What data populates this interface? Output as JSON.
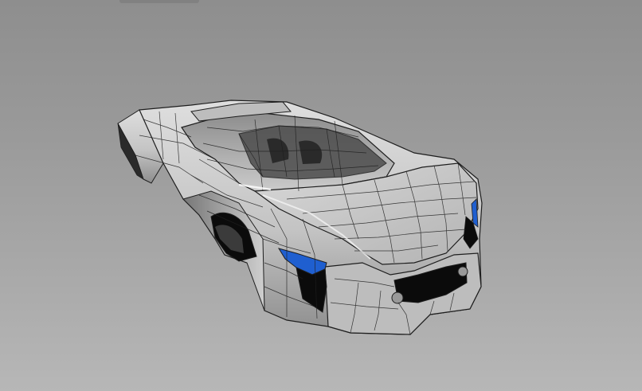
{
  "viewport": {
    "background_top": "#8e8e8e",
    "background_bottom": "#b7b7b7"
  },
  "model": {
    "subject": "wireframe-car-body",
    "surface_color": "#c9c9c9",
    "shadow_color": "#5a5a5a",
    "wire_color": "#1e1e1e",
    "accent_color": "#1f5fd0",
    "cavity_color": "#0b0b0b"
  }
}
